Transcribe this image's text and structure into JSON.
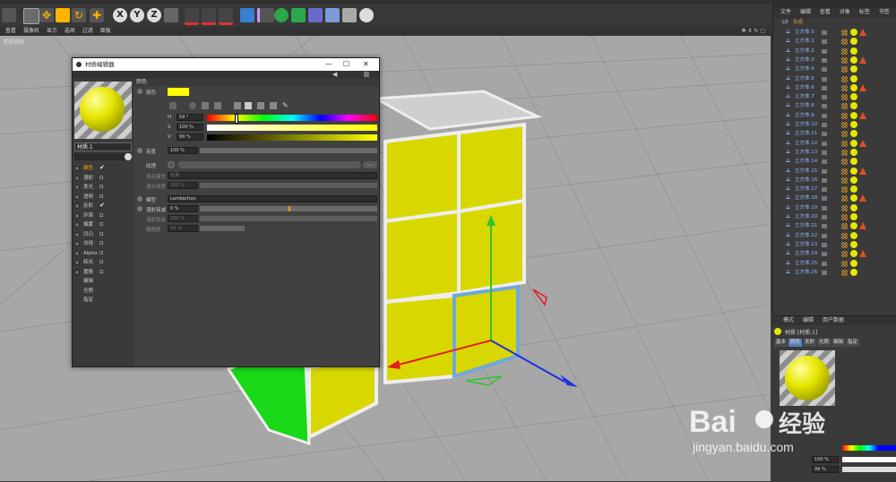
{
  "window_title": "材质编辑器",
  "window_controls": [
    "—",
    "☐",
    "✕"
  ],
  "viewport": {
    "menu": [
      "查看",
      "摄像机",
      "显示",
      "选项",
      "过滤",
      "面板"
    ],
    "label": "透视视图"
  },
  "toolbar_axes": [
    "X",
    "Y",
    "Z"
  ],
  "object_manager": {
    "menu": [
      "文件",
      "编辑",
      "查看",
      "对象",
      "标签",
      "书签"
    ],
    "root_label": "L0",
    "root_suffix": "合成",
    "objects": [
      "立方体.0",
      "立方体.1",
      "立方体.2",
      "立方体.3",
      "立方体.4",
      "立方体.5",
      "立方体.6",
      "立方体.7",
      "立方体.8",
      "立方体.9",
      "立方体.10",
      "立方体.11",
      "立方体.12",
      "立方体.13",
      "立方体.14",
      "立方体.15",
      "立方体.16",
      "立方体.17",
      "立方体.18",
      "立方体.19",
      "立方体.20",
      "立方体.21",
      "立方体.22",
      "立方体.23",
      "立方体.24",
      "立方体.25",
      "立方体.26"
    ]
  },
  "attributes": {
    "menu": [
      "模式",
      "编辑",
      "用户数据"
    ],
    "material_name": "材质 [材质.1]",
    "tabs": [
      "基本",
      "颜色",
      "发射",
      "光照",
      "编辑",
      "指定"
    ],
    "hsv": {
      "s": "100 %",
      "v": "99 %"
    }
  },
  "material_editor": {
    "name_field": "材质.1",
    "channels": [
      {
        "label": "颜色",
        "checked": true
      },
      {
        "label": "漫射",
        "checked": false
      },
      {
        "label": "发光",
        "checked": false
      },
      {
        "label": "透明",
        "checked": false
      },
      {
        "label": "反射",
        "checked": true
      },
      {
        "label": "环境",
        "checked": false
      },
      {
        "label": "烟雾",
        "checked": false
      },
      {
        "label": "凹凸",
        "checked": false
      },
      {
        "label": "法线",
        "checked": false
      },
      {
        "label": "Alpha",
        "checked": false
      },
      {
        "label": "辉光",
        "checked": false
      },
      {
        "label": "置换",
        "checked": false
      }
    ],
    "extra_items": [
      "编辑",
      "光照",
      "指定"
    ],
    "section_title": "颜色",
    "color_label": "颜色",
    "swatch_color": "#ffff00",
    "h_label": "H",
    "h_value": "59 °",
    "h_fraction": 0.164,
    "s_label": "S",
    "s_value": "100 %",
    "v_label": "V",
    "v_value": "99 %",
    "brightness_label": "亮度",
    "brightness_value": "100 %",
    "texture_label": "纹理",
    "mix_mode_label": "混合模式",
    "mix_mode_value": "标准",
    "mix_strength_label": "混合强度",
    "mix_strength_value": "100 %",
    "model_label": "模型",
    "model_value": "Lambertian",
    "diffuse_falloff_label": "漫射衰减",
    "diffuse_falloff_value": "0 %",
    "diffuse_level_label": "漫射层级",
    "diffuse_level_value": "100 %",
    "roughness_label": "粗糙度",
    "roughness_value": "50 %"
  },
  "colors": {
    "accent_yellow": "#ffff00",
    "cube_yellow": "#d8d800",
    "selection_blue": "#6fa8dc"
  },
  "watermark": "Baidu经验 jingyan.baidu.com"
}
